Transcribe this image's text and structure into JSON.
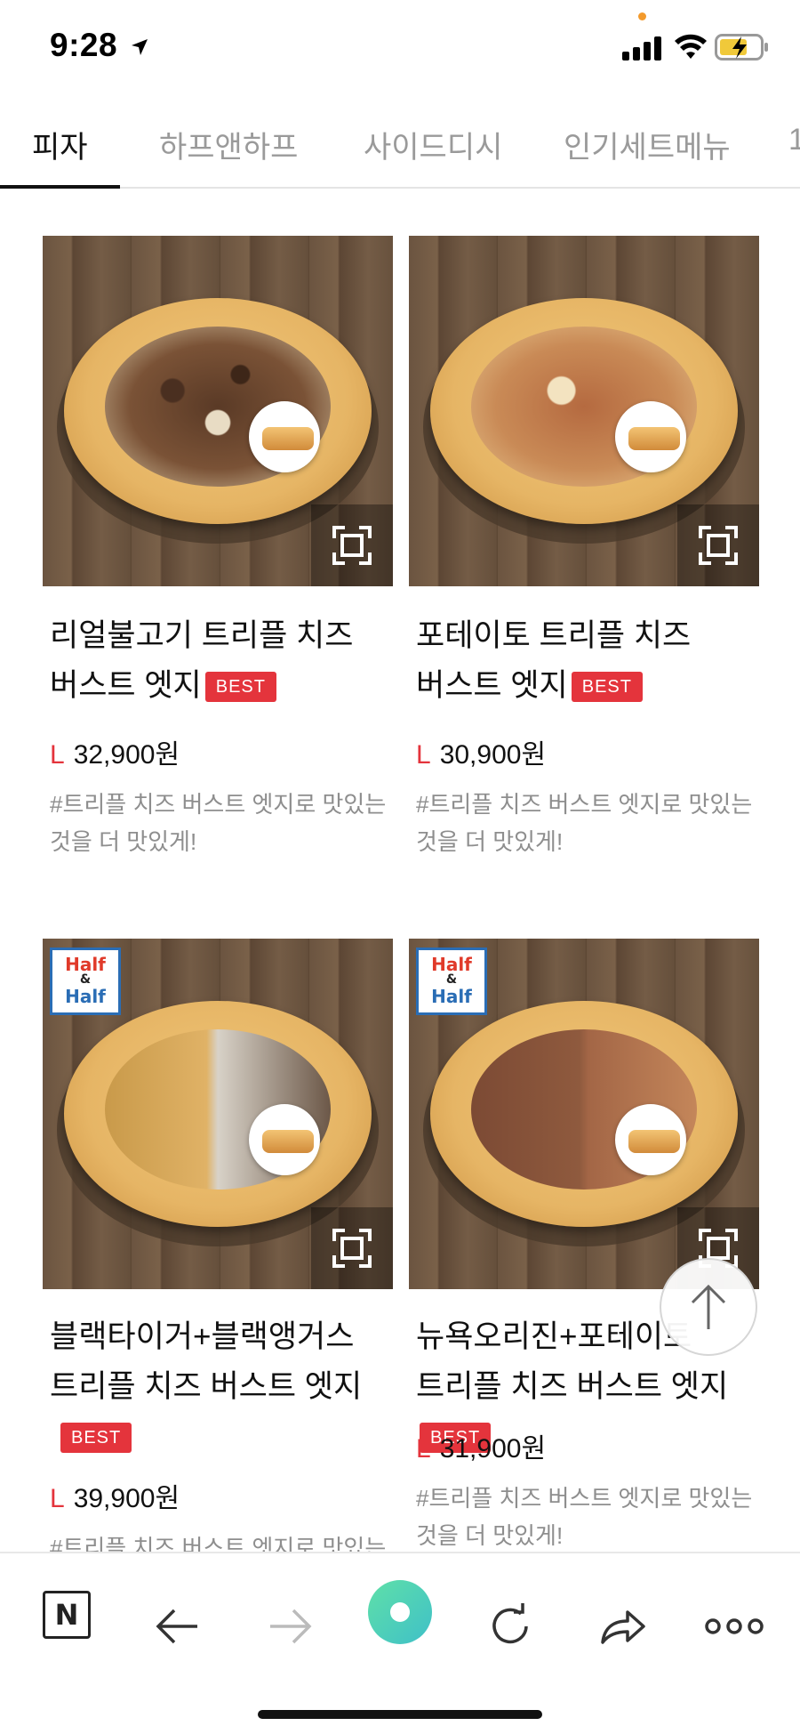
{
  "status_bar": {
    "time": "9:28"
  },
  "tabs": [
    {
      "label": "피자"
    },
    {
      "label": "하프앤하프"
    },
    {
      "label": "사이드디시"
    },
    {
      "label": "인기세트메뉴"
    },
    {
      "label": "1"
    }
  ],
  "badge_label": "BEST",
  "half_badge": {
    "line1": "Half",
    "amp": "&",
    "line2": "Half"
  },
  "products": [
    {
      "name": "리얼불고기 트리플 치즈 버스트 엣지",
      "best": true,
      "size": "L",
      "price": "32,900원",
      "desc": "#트리플 치즈 버스트 엣지로 맛있는 것을 더 맛있게!"
    },
    {
      "name": "포테이토 트리플 치즈 버스트 엣지",
      "best": true,
      "size": "L",
      "price": "30,900원",
      "desc": "#트리플 치즈 버스트 엣지로 맛있는 것을 더 맛있게!"
    },
    {
      "name": "블랙타이거+블랙앵거스 트리플 치즈 버스트 엣지",
      "best": true,
      "size": "L",
      "price": "39,900원",
      "desc": "#트리플 치즈 버스트 엣지로 맛있는 것"
    },
    {
      "name": "뉴욕오리진+포테이토 트리플 치즈 버스트 엣지",
      "best": true,
      "size": "L",
      "price": "31,900원",
      "desc": "#트리플 치즈 버스트 엣지로 맛있는 것을 더 맛있게!"
    }
  ],
  "bottom_bar": {
    "n_label": "N"
  },
  "colors": {
    "accent_red": "#e4343c",
    "tab_active": "#111111",
    "tab_inactive": "#9a9a9a",
    "green": "#4fd0b8"
  }
}
